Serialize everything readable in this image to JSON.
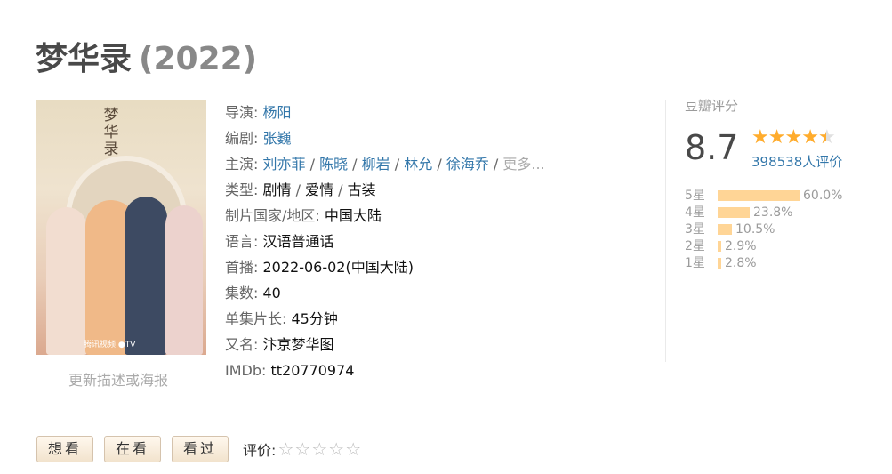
{
  "title": {
    "name": "梦华录",
    "year": "(2022)"
  },
  "poster": {
    "calligraphy": "梦华录",
    "logos": "腾讯视频   ●TV"
  },
  "update_link": "更新描述或海报",
  "info": {
    "director": {
      "label": "导演",
      "names": [
        "杨阳"
      ]
    },
    "writer": {
      "label": "编剧",
      "names": [
        "张巍"
      ]
    },
    "cast": {
      "label": "主演",
      "names": [
        "刘亦菲",
        "陈晓",
        "柳岩",
        "林允",
        "徐海乔"
      ],
      "more": "更多..."
    },
    "genre": {
      "label": "类型",
      "values": [
        "剧情",
        "爱情",
        "古装"
      ]
    },
    "country": {
      "label": "制片国家/地区",
      "value": "中国大陆"
    },
    "language": {
      "label": "语言",
      "value": "汉语普通话"
    },
    "premiere": {
      "label": "首播",
      "value": "2022-06-02(中国大陆)"
    },
    "episodes": {
      "label": "集数",
      "value": "40"
    },
    "episode_length": {
      "label": "单集片长",
      "value": "45分钟"
    },
    "aka": {
      "label": "又名",
      "value": "汴京梦华图"
    },
    "imdb": {
      "label": "IMDb",
      "value": "tt20770974"
    }
  },
  "rating": {
    "label": "豆瓣评分",
    "score": "8.7",
    "stars_value": 4.5,
    "count": "398538人评价",
    "breakdown": [
      {
        "label": "5星",
        "percent": 60.0,
        "text": "60.0%"
      },
      {
        "label": "4星",
        "percent": 23.8,
        "text": "23.8%"
      },
      {
        "label": "3星",
        "percent": 10.5,
        "text": "10.5%"
      },
      {
        "label": "2星",
        "percent": 2.9,
        "text": "2.9%"
      },
      {
        "label": "1星",
        "percent": 2.8,
        "text": "2.8%"
      }
    ]
  },
  "actions": {
    "want": "想看",
    "watching": "在看",
    "watched": "看过",
    "rate_label": "评价:"
  },
  "colors": {
    "link": "#3377aa",
    "star": "#ffac2d",
    "bar": "#ffd596"
  }
}
